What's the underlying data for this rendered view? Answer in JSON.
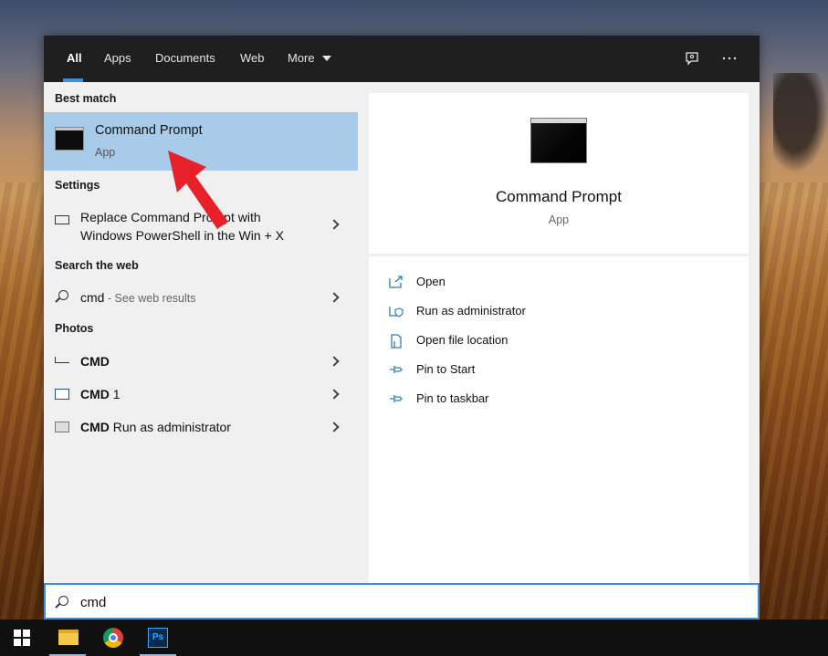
{
  "tabs": [
    {
      "label": "All",
      "active": true
    },
    {
      "label": "Apps"
    },
    {
      "label": "Documents"
    },
    {
      "label": "Web"
    },
    {
      "label": "More"
    }
  ],
  "sections": {
    "best_match": "Best match",
    "settings": "Settings",
    "search_web": "Search the web",
    "photos": "Photos"
  },
  "best_match": {
    "title": "Command Prompt",
    "subtitle": "App"
  },
  "settings_item": {
    "line1": "Replace Command Prompt with",
    "line2": "Windows PowerShell in the Win + X"
  },
  "web_item": {
    "query": "cmd",
    "suffix": " - See web results"
  },
  "photos": [
    {
      "bold": "CMD",
      "rest": ""
    },
    {
      "bold": "CMD",
      "rest": " 1"
    },
    {
      "bold": "CMD",
      "rest": " Run as administrator"
    }
  ],
  "detail": {
    "title": "Command Prompt",
    "subtitle": "App"
  },
  "actions": [
    {
      "label": "Open",
      "icon": "open-icon"
    },
    {
      "label": "Run as administrator",
      "icon": "shield-icon"
    },
    {
      "label": "Open file location",
      "icon": "file-location-icon"
    },
    {
      "label": "Pin to Start",
      "icon": "pin-icon"
    },
    {
      "label": "Pin to taskbar",
      "icon": "pin-icon"
    }
  ],
  "search": {
    "value": "cmd"
  },
  "colors": {
    "accent": "#3f8fd8",
    "selection": "#a7cbe9",
    "arrow": "#e8202a"
  }
}
